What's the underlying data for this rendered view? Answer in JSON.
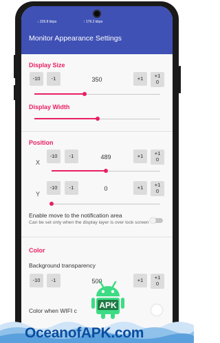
{
  "status_bar": {
    "net_down": "226.8 kbps",
    "net_up": "176.2 kbps"
  },
  "app_bar": {
    "title": "Monitor Appearance Settings"
  },
  "display_size": {
    "title": "Display Size",
    "buttons": {
      "minus10": "-10",
      "minus1": "-1",
      "plus1": "+1",
      "plus1_0_top": "+1",
      "plus1_0_bottom": "0"
    },
    "value": "350",
    "slider_fraction": 0.4
  },
  "display_width": {
    "title": "Display Width",
    "slider_fraction": 0.5
  },
  "position": {
    "title": "Position",
    "x": {
      "label": "X",
      "buttons": {
        "minus10": "-10",
        "minus1": "-1",
        "plus1": "+1",
        "plus1_0_top": "+1",
        "plus1_0_bottom": "0"
      },
      "value": "489",
      "slider_fraction": 0.5
    },
    "y": {
      "label": "Y",
      "buttons": {
        "minus10": "-10",
        "minus1": "-1",
        "plus1": "+1",
        "plus1_0_top": "+1",
        "plus1_0_bottom": "0"
      },
      "value": "0",
      "slider_fraction": 0.0
    }
  },
  "notification_area": {
    "label": "Enable move to the notification area",
    "description": "Can be set only when the display layer is over lock screen",
    "enabled": false
  },
  "color": {
    "title": "Color",
    "background_transparency": {
      "label": "Background transparency",
      "buttons": {
        "minus10": "-10",
        "minus1": "-1",
        "plus1": "+1",
        "plus1_0_top": "+1",
        "plus1_0_bottom": "0"
      },
      "value": "500"
    },
    "wifi_label": "Color when WIFI c"
  },
  "watermark": {
    "logo_text": "APK",
    "site": "OceanofAPK.com"
  },
  "colors": {
    "accent": "#e91e63",
    "app_bar": "#3f51b5",
    "button": "#dcdcdc",
    "watermark_text": "#0a4da0",
    "android_green": "#3ddc84"
  },
  "icons": {
    "camera": "front-camera-icon",
    "logo": "android-apk-logo-icon"
  }
}
